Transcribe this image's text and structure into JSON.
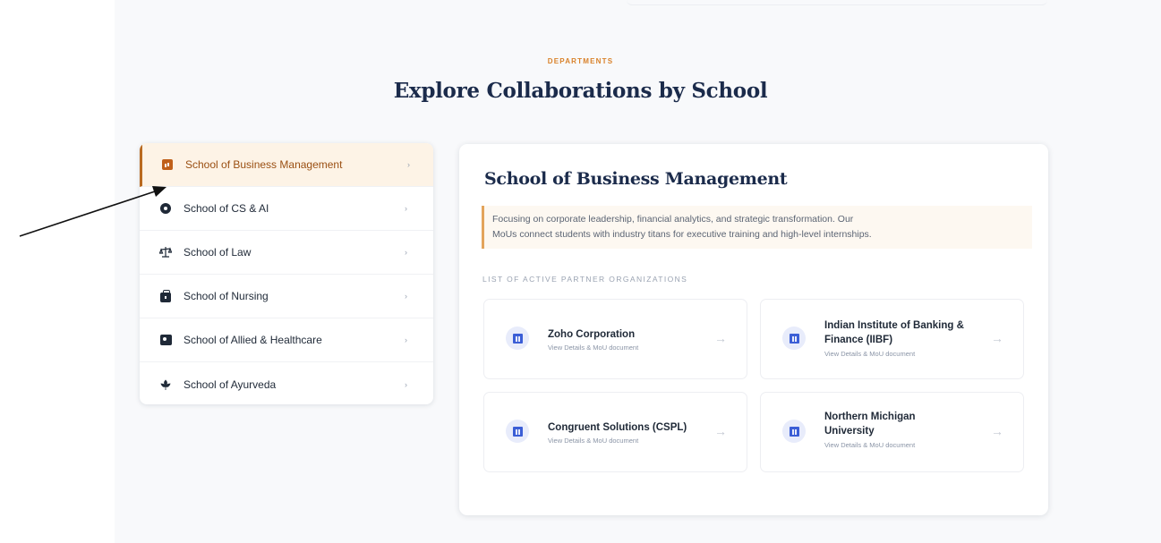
{
  "section": {
    "eyebrow": "DEPARTMENTS",
    "title": "Explore Collaborations by School"
  },
  "sidebar": {
    "items": [
      {
        "label": "School of Business Management",
        "icon": "chart-box-icon",
        "active": true
      },
      {
        "label": "School of CS & AI",
        "icon": "chip-icon",
        "active": false
      },
      {
        "label": "School of Law",
        "icon": "scales-icon",
        "active": false
      },
      {
        "label": "School of Nursing",
        "icon": "medical-bag-icon",
        "active": false
      },
      {
        "label": "School of Allied & Healthcare",
        "icon": "id-card-icon",
        "active": false
      },
      {
        "label": "School of Ayurveda",
        "icon": "leaf-icon",
        "active": false
      }
    ],
    "chevron": "›"
  },
  "detail": {
    "title": "School of Business Management",
    "description_line1": "Focusing on corporate leadership, financial analytics, and strategic transformation. Our",
    "description_line2": "MoUs connect students with industry titans for executive training and high-level internships.",
    "list_heading": "LIST OF ACTIVE PARTNER ORGANIZATIONS",
    "partners": [
      {
        "name_line1": "Zoho Corporation",
        "name_line2": "",
        "sub": "View Details & MoU document"
      },
      {
        "name_line1": "Indian Institute of Banking &",
        "name_line2": "Finance (IIBF)",
        "sub": "View Details & MoU document"
      },
      {
        "name_line1": "Congruent Solutions (CSPL)",
        "name_line2": "",
        "sub": "View Details & MoU document"
      },
      {
        "name_line1": "Northern Michigan",
        "name_line2": "University",
        "sub": "View Details & MoU document"
      }
    ],
    "arrow": "→"
  },
  "colors": {
    "accent": "#d9822b",
    "active_bg": "#fdf3e6",
    "heading": "#1b2b4b",
    "partner_icon": "#3b5ed6"
  }
}
